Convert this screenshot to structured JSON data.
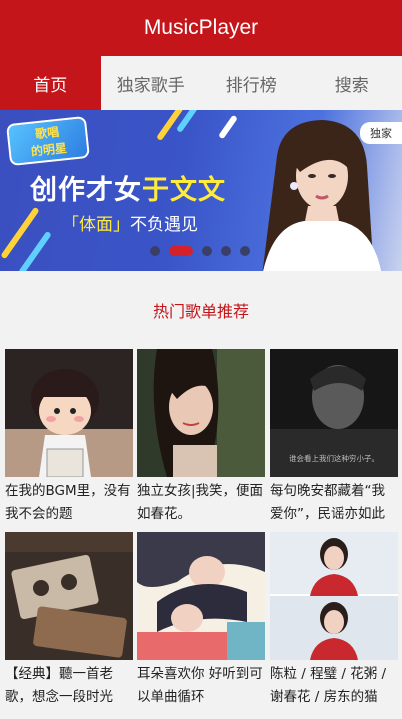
{
  "app": {
    "title": "MusicPlayer"
  },
  "tabs": [
    {
      "label": "首页",
      "active": true
    },
    {
      "label": "独家歌手",
      "active": false
    },
    {
      "label": "排行榜",
      "active": false
    },
    {
      "label": "搜索",
      "active": false
    }
  ],
  "banner": {
    "logo_line1": "歌唱",
    "logo_line2": "的明星",
    "headline_prefix": "创作才女",
    "headline_highlight": "于文文",
    "sub_highlight": "「体面」",
    "sub_rest": "不负遇见",
    "badge": "独家",
    "slide_count": 5,
    "active_slide": 2
  },
  "section": {
    "title": "热门歌单推荐"
  },
  "playlists": [
    {
      "title": "在我的BGM里，没有我不会的题"
    },
    {
      "title": "独立女孩|我笑，便面如春花。"
    },
    {
      "title": "每句晚安都藏着“我爱你”，民谣亦如此"
    },
    {
      "title": "【经典】聽一首老歌，想念一段时光"
    },
    {
      "title": "耳朵喜欢你 好听到可以单曲循环"
    },
    {
      "title": "陈粒 / 程璧 / 花粥 / 谢春花 / 房东的猫"
    }
  ],
  "cover_texts": {
    "quote": "谁会看上我们这种穷小子。"
  },
  "colors": {
    "brand": "#c4151a",
    "page_bg": "#f2f2f2",
    "text": "#222222",
    "inactive_tab": "#666666"
  }
}
